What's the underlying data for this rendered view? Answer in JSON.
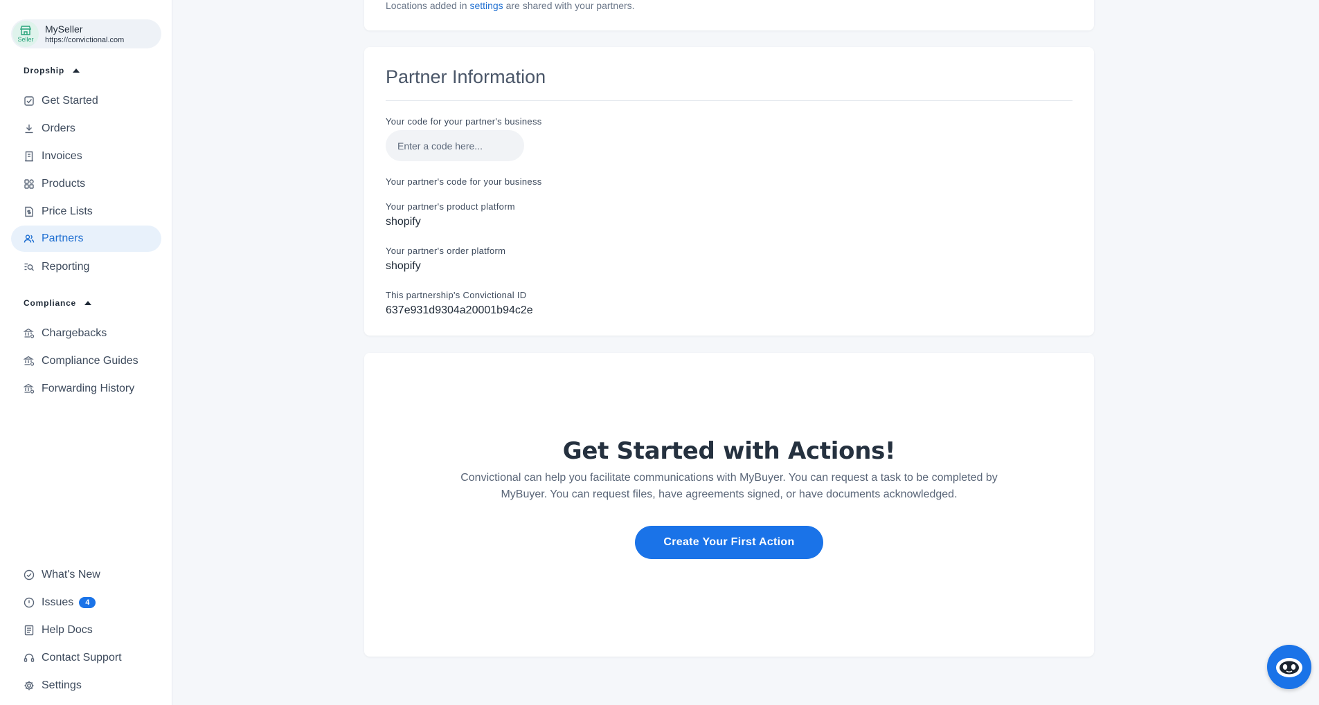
{
  "account": {
    "name": "MySeller",
    "url": "https://convictional.com",
    "role": "Seller"
  },
  "sidebar": {
    "dropship_label": "Dropship",
    "dropship_items": [
      {
        "label": "Get Started",
        "icon": "checkbox-icon"
      },
      {
        "label": "Orders",
        "icon": "download-icon"
      },
      {
        "label": "Invoices",
        "icon": "receipt-icon"
      },
      {
        "label": "Products",
        "icon": "grid-icon"
      },
      {
        "label": "Price Lists",
        "icon": "dollar-doc-icon"
      },
      {
        "label": "Partners",
        "icon": "users-icon",
        "active": true
      },
      {
        "label": "Reporting",
        "icon": "report-search-icon"
      }
    ],
    "compliance_label": "Compliance",
    "compliance_items": [
      {
        "label": "Chargebacks",
        "icon": "bank-icon"
      },
      {
        "label": "Compliance Guides",
        "icon": "bank-icon"
      },
      {
        "label": "Forwarding History",
        "icon": "bank-icon"
      }
    ],
    "bottom_items": [
      {
        "label": "What's New",
        "icon": "check-circle-icon"
      },
      {
        "label": "Issues",
        "icon": "alert-circle-icon",
        "badge": "4"
      },
      {
        "label": "Help Docs",
        "icon": "document-icon"
      },
      {
        "label": "Contact Support",
        "icon": "headset-icon"
      },
      {
        "label": "Settings",
        "icon": "gear-icon"
      }
    ]
  },
  "locations": {
    "prefix": "Locations added in",
    "link": "settings",
    "suffix": "are shared with your partners."
  },
  "partner": {
    "title": "Partner Information",
    "your_code_label": "Your code for your partner's business",
    "your_code_placeholder": "Enter a code here...",
    "partner_code_label": "Your partner's code for your business",
    "product_platform_label": "Your partner's product platform",
    "product_platform": "shopify",
    "order_platform_label": "Your partner's order platform",
    "order_platform": "shopify",
    "id_label": "This partnership's Convictional ID",
    "id_value": "637e931d9304a20001b94c2e"
  },
  "actions": {
    "title": "Get Started with Actions!",
    "description": "Convictional can help you facilitate communications with MyBuyer. You can request a task to be completed by MyBuyer. You can request files, have agreements signed, or have documents acknowledged.",
    "button_label": "Create Your First Action"
  },
  "colors": {
    "accent": "#1a73e8",
    "active_bg": "#e8f1fb",
    "page_bg": "#f5f7fa"
  }
}
